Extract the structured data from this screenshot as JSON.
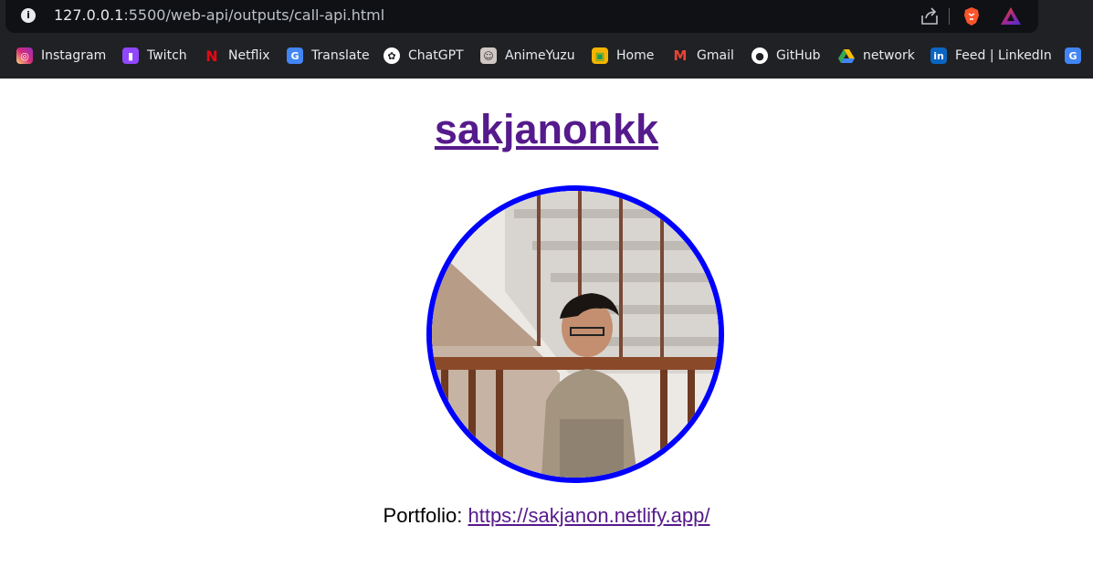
{
  "browser": {
    "url_host": "127.0.0.1",
    "url_rest": ":5500/web-api/outputs/call-api.html",
    "icons": [
      "info-icon",
      "share-icon",
      "brave-icon",
      "triangle-icon"
    ]
  },
  "bookmarks": [
    {
      "label": "Instagram",
      "icon": "instagram-icon",
      "color": "#d6249f"
    },
    {
      "label": "Twitch",
      "icon": "twitch-icon",
      "color": "#9146ff"
    },
    {
      "label": "Netflix",
      "icon": "netflix-icon",
      "color": "#e50914"
    },
    {
      "label": "Translate",
      "icon": "translate-icon",
      "color": "#4285f4"
    },
    {
      "label": "ChatGPT",
      "icon": "chatgpt-icon",
      "color": "#ffffff"
    },
    {
      "label": "AnimeYuzu",
      "icon": "animeyuzu-icon",
      "color": "#cfc7c2"
    },
    {
      "label": "Home",
      "icon": "home-icon",
      "color": "#f4b400"
    },
    {
      "label": "Gmail",
      "icon": "gmail-icon",
      "color": "#ea4335"
    },
    {
      "label": "GitHub",
      "icon": "github-icon",
      "color": "#ffffff"
    },
    {
      "label": "network",
      "icon": "drive-icon",
      "color": "#34a853"
    },
    {
      "label": "Feed | LinkedIn",
      "icon": "linkedin-icon",
      "color": "#0a66c2"
    }
  ],
  "profile": {
    "username": "sakjanonkk",
    "portfolio_label": "Portfolio:",
    "portfolio_url": "https://sakjanon.netlify.app/",
    "avatar_border_color": "#0000ff",
    "link_color": "#551a8b"
  }
}
